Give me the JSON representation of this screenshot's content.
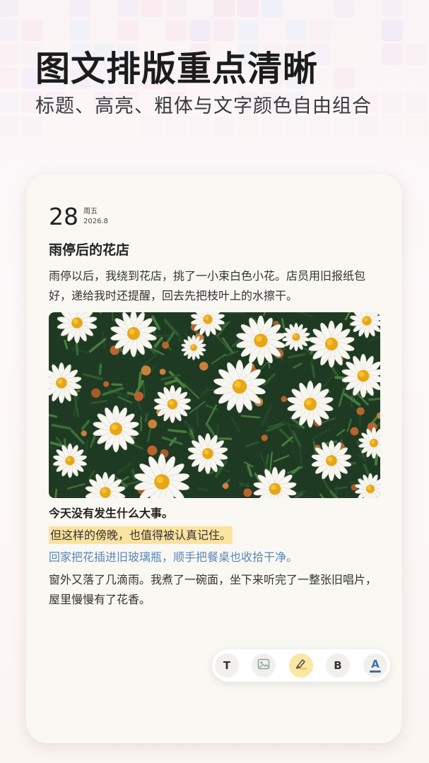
{
  "hero": {
    "title": "图文排版重点清晰",
    "subtitle": "标题、高亮、粗体与文字颜色自由组合"
  },
  "note": {
    "day": "28",
    "weekday": "周五",
    "year_month": "2026.8",
    "title": "雨停后的花店",
    "paragraph1": "雨停以后，我绕到花店，挑了一小束白色小花。店员用旧报纸包好，递给我时还提醒，回去先把枝叶上的水擦干。",
    "line_bold": "今天没有发生什么大事。",
    "line_highlight": "但这样的傍晚，也值得被认真记住。",
    "line_blue": "回家把花插进旧玻璃瓶，顺手把餐桌也收拾干净。",
    "paragraph2": "窗外又落了几滴雨。我煮了一碗面，坐下来听完了一整张旧唱片，屋里慢慢有了花香。"
  },
  "toolbar": {
    "text_label": "T",
    "bold_label": "B",
    "color_label": "A",
    "icons": [
      "text-icon",
      "image-icon",
      "highlighter-icon",
      "bold-icon",
      "font-color-icon"
    ]
  },
  "colors": {
    "highlight": "#fbe3a0",
    "accent_blue": "#5b87b8",
    "font_color": "#3d6fa6",
    "card": "#f9f8f3"
  }
}
